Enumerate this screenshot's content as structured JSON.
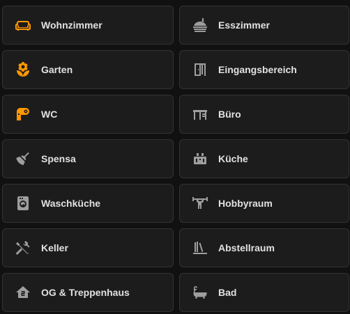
{
  "colors": {
    "background": "#111111",
    "card": "#1c1c1c",
    "border": "#333333",
    "text": "#e1e1e1",
    "icon_active": "#ff9800",
    "icon_inactive": "#9e9e9e"
  },
  "rooms": [
    {
      "label": "Wohnzimmer",
      "icon": "sofa-icon",
      "active": true
    },
    {
      "label": "Esszimmer",
      "icon": "food-icon",
      "active": false
    },
    {
      "label": "Garten",
      "icon": "flower-icon",
      "active": true
    },
    {
      "label": "Eingangsbereich",
      "icon": "door-icon",
      "active": false
    },
    {
      "label": "WC",
      "icon": "toilet-paper-icon",
      "active": true
    },
    {
      "label": "Büro",
      "icon": "desk-icon",
      "active": false
    },
    {
      "label": "Spensa",
      "icon": "broom-icon",
      "active": false
    },
    {
      "label": "Küche",
      "icon": "toaster-icon",
      "active": false
    },
    {
      "label": "Waschküche",
      "icon": "washing-machine-icon",
      "active": false
    },
    {
      "label": "Hobbyraum",
      "icon": "weight-lifter-icon",
      "active": false
    },
    {
      "label": "Keller",
      "icon": "tools-icon",
      "active": false
    },
    {
      "label": "Abstellraum",
      "icon": "bookshelf-icon",
      "active": false
    },
    {
      "label": "OG & Treppenhaus",
      "icon": "home-floor-2-icon",
      "active": false
    },
    {
      "label": "Bad",
      "icon": "bathtub-icon",
      "active": false
    }
  ]
}
